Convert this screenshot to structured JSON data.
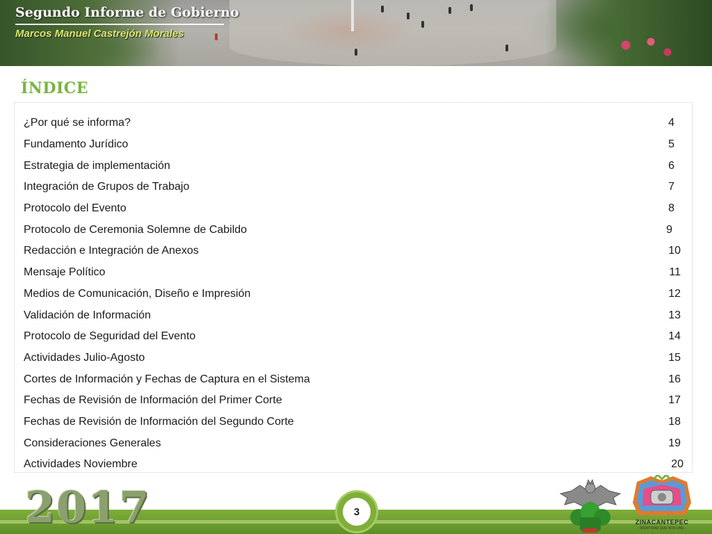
{
  "header": {
    "title": "Segundo Informe de Gobierno",
    "subtitle": "Marcos Manuel Castrejón Morales"
  },
  "index": {
    "heading": "ÍNDICE",
    "items": [
      {
        "label": "¿Por qué se informa?",
        "page": "4"
      },
      {
        "label": "Fundamento Jurídico",
        "page": "5"
      },
      {
        "label": "Estrategia de implementación",
        "page": "6"
      },
      {
        "label": "Integración de Grupos de Trabajo",
        "page": "7"
      },
      {
        "label": "Protocolo del Evento",
        "page": "8"
      },
      {
        "label": "Protocolo de Ceremonia Solemne de Cabildo",
        "page": "9"
      },
      {
        "label": "Redacción e Integración de Anexos",
        "page": "10"
      },
      {
        "label": "Mensaje Político",
        "page": "11"
      },
      {
        "label": "Medios de Comunicación, Diseño e Impresión",
        "page": "12"
      },
      {
        "label": "Validación de Información",
        "page": "13"
      },
      {
        "label": "Protocolo de Seguridad del Evento",
        "page": "14"
      },
      {
        "label": "Actividades Julio-Agosto",
        "page": "15"
      },
      {
        "label": "Cortes de Información y Fechas de Captura en el Sistema",
        "page": "16"
      },
      {
        "label": "Fechas de Revisión de Información del Primer Corte",
        "page": "17"
      },
      {
        "label": "Fechas de Revisión de Información del Segundo Corte",
        "page": "18"
      },
      {
        "label": "Consideraciones Generales",
        "page": "19"
      },
      {
        "label": "Actividades Noviembre",
        "page": "20"
      }
    ]
  },
  "footer": {
    "year": "2017",
    "page_number": "3",
    "municipality": "ZINACANTEPEC",
    "motto": "- IDENTIDAD QUE NOS UNE -"
  },
  "colors": {
    "accent_green": "#7ab441",
    "footer_green": "#7fae3a"
  }
}
